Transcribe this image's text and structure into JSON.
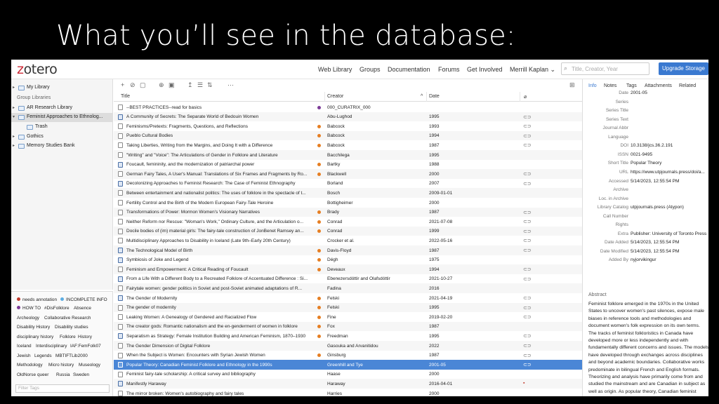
{
  "slide": {
    "title": "What you’ll see in the database:"
  },
  "nav": {
    "logo_prefix": "z",
    "logo_rest": "otero",
    "links": [
      "Web Library",
      "Groups",
      "Documentation",
      "Forums",
      "Get Involved",
      "Merrill Kaplan"
    ],
    "user_chevron": "⌄",
    "search_placeholder": "Title, Creator, Year",
    "upgrade_label": "Upgrade Storage"
  },
  "collections": [
    {
      "label": "My Library",
      "indent": 0,
      "twisty": "▸",
      "folder": true
    },
    {
      "label": "Group Libraries",
      "indent": 0,
      "header": true
    },
    {
      "label": "AR Research Library",
      "indent": 0,
      "twisty": "▸",
      "folder": true
    },
    {
      "label": "Feminist Approaches to Ethnolog...",
      "indent": 0,
      "twisty": "▾",
      "folder": true,
      "selected": true
    },
    {
      "label": "Trash",
      "indent": 1,
      "folder": true
    },
    {
      "label": "Gothics",
      "indent": 0,
      "twisty": "▸",
      "folder": true
    },
    {
      "label": "Memory Studies Bank",
      "indent": 0,
      "twisty": "▸",
      "folder": true
    }
  ],
  "tags": {
    "colored": [
      {
        "label": "needs annotation",
        "color": "#c0392b"
      },
      {
        "label": "INCOMPLETE INFO",
        "color": "#5dade2"
      },
      {
        "label": "HOW TO",
        "color": "#7d3c98"
      }
    ],
    "rows": [
      [
        "#DisFolklore",
        "Absence"
      ],
      [
        "Archeology",
        "Collaborative Research"
      ],
      [
        "Disability History",
        "Disability studies"
      ],
      [
        "disciplinary history",
        "Folklore",
        "History"
      ],
      [
        "Iceland",
        "Interdisciplinary",
        "IAF:FemFolk07"
      ],
      [
        "Jewish",
        "Legends",
        "MBTIFTLib2000"
      ],
      [
        "Methodology",
        "Micro history",
        "Museology"
      ],
      [
        "OldNorse",
        "queer",
        "Russia",
        "Sweden"
      ]
    ],
    "filter_placeholder": "Filter Tags"
  },
  "toolbar": {
    "icons": [
      "+",
      "⊘",
      "▢",
      "⊕",
      "▣",
      "↥",
      "☰",
      "⇅",
      "⋯"
    ],
    "layout_icon": "⊞"
  },
  "columns": {
    "title": "Title",
    "creator": "Creator",
    "sort_arrow": "^",
    "date": "Date",
    "attach": "⌀"
  },
  "items": [
    {
      "title": "--BEST PRACTICES--read for basics",
      "creator": "000_CURATRIX_000",
      "date": "",
      "dot": "#7d3c98",
      "book": false,
      "att": ""
    },
    {
      "title": "A Community of Secrets: The Separate World of Bedouin Women",
      "creator": "Abu-Lughod",
      "date": "1995",
      "book": true,
      "att": "⊂⊃"
    },
    {
      "title": "Feminisms/Pretexts: Fragments, Questions, and Reflections",
      "creator": "Babcock",
      "date": "1993",
      "dot": "#e67e22",
      "att": "⊂⊃"
    },
    {
      "title": "Pueblo Cultural Bodies",
      "creator": "Babcock",
      "date": "1994",
      "dot": "#e67e22",
      "att": "⊂⊃"
    },
    {
      "title": "Taking Liberties, Writing from the Margins, and Doing It with a Difference",
      "creator": "Babcock",
      "date": "1987",
      "dot": "#e67e22",
      "att": "⊂⊃"
    },
    {
      "title": "\"Writing\" and \"Voice\": The Articulations of Gender in Folklore and Literature",
      "creator": "Bacchilega",
      "date": "1995",
      "att": ""
    },
    {
      "title": "Foucault, femininity, and the modernization of patriarchal power",
      "creator": "Bartky",
      "date": "1988",
      "dot": "#e67e22",
      "book": true,
      "att": ""
    },
    {
      "title": "German Fairy Tales, A User's Manual: Translations of Six Frames and Fragments by Ro...",
      "creator": "Blackwell",
      "date": "2000",
      "dot": "#e67e22",
      "att": "⊂⊃"
    },
    {
      "title": "Decolonizing Approaches to Feminist Research: The Case of Feminist Ethnography",
      "creator": "Borland",
      "date": "2007",
      "book": true,
      "att": "⊂⊃"
    },
    {
      "title": "Between entertainment and nationalist politics: The uses of folklore in the spectacle of t...",
      "creator": "Bosch",
      "date": "2009-01-01",
      "att": ""
    },
    {
      "title": "Fertility Control and the Birth of the Modern European Fairy-Tale Heroine",
      "creator": "Bottigheimer",
      "date": "2000",
      "att": ""
    },
    {
      "title": "Transformations of Power: Mormon Women's Visionary Narratives",
      "creator": "Brady",
      "date": "1987",
      "dot": "#e67e22",
      "att": "⊂⊃"
    },
    {
      "title": "Neither Reform nor Rescue: \"Woman's Work,\" Ordinary Culture, and the Articulation o...",
      "creator": "Conrad",
      "date": "2021-07-08",
      "dot": "#e67e22",
      "att": "⊂⊃"
    },
    {
      "title": "Docile bodies of (im) material girls: The fairy-tale construction of JonBenet Ramsey an...",
      "creator": "Conrad",
      "date": "1999",
      "dot": "#e67e22",
      "att": "⊂⊃"
    },
    {
      "title": "Multidisciplinary Approaches to Disability in Iceland (Late 9th–Early 20th Century)",
      "creator": "Crocker et al.",
      "date": "2022-05-16",
      "att": "⊂⊃"
    },
    {
      "title": "The Technological Model of Birth",
      "creator": "Davis-Floyd",
      "date": "1987",
      "dot": "#e67e22",
      "book": true,
      "att": "⊂⊃"
    },
    {
      "title": "Symbiosis of Joke and Legend",
      "creator": "Dégh",
      "date": "1975",
      "dot": "#e67e22",
      "book": true,
      "att": ""
    },
    {
      "title": "Feminism and Empowerment: A Critical Reading of Foucault",
      "creator": "Deveaux",
      "date": "1994",
      "dot": "#e67e22",
      "att": "⊂⊃"
    },
    {
      "title": "From a Life With a Different Body to a Recreated Folklore of Accentuated Difference : Si...",
      "creator": "Ebenezersdóttir and Ólafsdóttir",
      "date": "2021-10-27",
      "book": true,
      "att": "⊂⊃"
    },
    {
      "title": "Fairytale women: gender politics in Soviet and post-Soviet animated adaptations of R...",
      "creator": "Fadina",
      "date": "2016",
      "att": ""
    },
    {
      "title": "The Gender of Modernity",
      "creator": "Felski",
      "date": "2021-04-19",
      "dot": "#e67e22",
      "book": true,
      "att": "⊂⊃"
    },
    {
      "title": "The gender of modernity",
      "creator": "Felski",
      "date": "1995",
      "dot": "#e67e22",
      "att": "⊂⊃"
    },
    {
      "title": "Leaking Women: A Genealogy of Gendered and Racialized Flow",
      "creator": "Fine",
      "date": "2019-02-20",
      "dot": "#e67e22",
      "att": "⊂⊃"
    },
    {
      "title": "The creator gods: Romantic nationalism and the en-genderment of women in folklore",
      "creator": "Fox",
      "date": "1987",
      "dot": "#e67e22",
      "att": ""
    },
    {
      "title": "Separatism as Strategy: Female Institution Building and American Feminism, 1870–1930",
      "creator": "Freedman",
      "date": "1995",
      "dot": "#e67e22",
      "book": true,
      "att": "⊂⊃"
    },
    {
      "title": "The Gender Dimension of Digital Folklore",
      "creator": "Gasouka and Arvanitidou",
      "date": "2022",
      "att": "⊂⊃"
    },
    {
      "title": "When the Subject is Women: Encounters with Syrian Jewish Women",
      "creator": "Ginsburg",
      "date": "1987",
      "dot": "#e67e22",
      "att": "⊂⊃"
    },
    {
      "title": "Popular Theory: Canadian Feminist Folklore and Ethnology in the 1990s",
      "creator": "Greenhill and Tye",
      "date": "2001-05",
      "selected": true,
      "att": "⊂⊃"
    },
    {
      "title": "Feminist fairy-tale scholarship: A critical survey and bibliography",
      "creator": "Haase",
      "date": "2000",
      "att": ""
    },
    {
      "title": "Manifestly Haraway",
      "creator": "Haraway",
      "date": "2016-04-01",
      "book": true,
      "att": "▪",
      "pdf": true
    },
    {
      "title": "The mirror broken: Women's autobiography and fairy tales",
      "creator": "Harries",
      "date": "2000",
      "att": ""
    }
  ],
  "info": {
    "tabs": [
      "Info",
      "Notes",
      "Tags",
      "Attachments",
      "Related"
    ],
    "fields": [
      {
        "label": "Date",
        "value": "2001-05"
      },
      {
        "label": "Series",
        "value": ""
      },
      {
        "label": "Series Title",
        "value": ""
      },
      {
        "label": "Series Text",
        "value": ""
      },
      {
        "label": "Journal Abbr",
        "value": ""
      },
      {
        "label": "Language",
        "value": ""
      },
      {
        "label": "DOI",
        "value": "10.3138/jcs.36.2.191"
      },
      {
        "label": "ISSN",
        "value": "0021-9495"
      },
      {
        "label": "Short Title",
        "value": "Popular Theory"
      },
      {
        "label": "URL",
        "value": "https://www.utpjournals.press/doi/a..."
      },
      {
        "label": "Accessed",
        "value": "5/14/2023, 12:55:54 PM"
      },
      {
        "label": "Archive",
        "value": ""
      },
      {
        "label": "Loc. in Archive",
        "value": ""
      },
      {
        "label": "Library Catalog",
        "value": "utpjournals.press (Atypon)"
      },
      {
        "label": "Call Number",
        "value": ""
      },
      {
        "label": "Rights",
        "value": ""
      },
      {
        "label": "Extra",
        "value": "Publisher: University of Toronto Press"
      },
      {
        "label": "Date Added",
        "value": "5/14/2023, 12:55:54 PM"
      },
      {
        "label": "Date Modified",
        "value": "5/14/2023, 12:55:54 PM"
      },
      {
        "label": "Added By",
        "value": "nyjorvikingur"
      }
    ],
    "abstract_label": "Abstract",
    "abstract": "Feminist folklore emerged in the 1970s in the United States to uncover women's past silences, expose male biases in reference tools and methodologies and document women's folk expression on its own terms. The tracks of feminist folkloristics in Canada have developed more or less independently and with fundamentally different concerns and issues. The models have developed through exchanges across disciplines and beyond academic boundaries. Collaborative works predominate in bilingual French and English formats. Theorizing and analysis have primarily come from and studied the mainstream and are Canadian in subject as well as origin. As popular theory, Canadian feminist folkloristics offers alternative, potentially transformative models."
  }
}
